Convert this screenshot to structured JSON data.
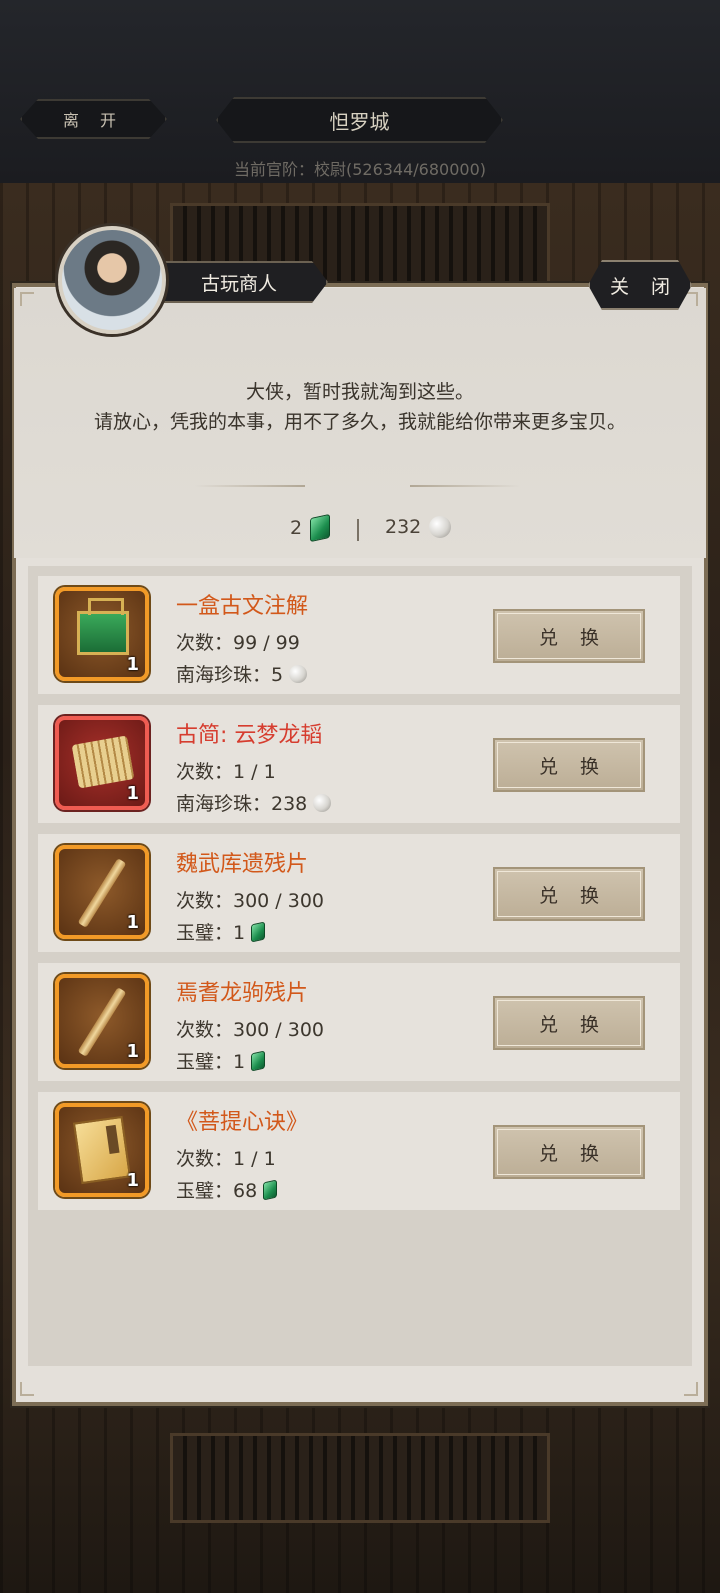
{
  "header": {
    "leave_label": "离 开",
    "city_title": "怛罗城",
    "rank_text": "当前官阶：校尉(526344/680000)"
  },
  "merchant": {
    "name": "古玩商人",
    "close_label": "关 闭",
    "dialog_line1": "大侠，暂时我就淘到这些。",
    "dialog_line2": "请放心，凭我的本事，用不了多久，我就能给你带来更多宝贝。"
  },
  "currency": {
    "jade_amount": "2",
    "separator": "|",
    "pearl_amount": "232",
    "jade_icon": "jade-icon",
    "pearl_icon": "pearl-icon"
  },
  "items": [
    {
      "name": "一盒古文注解",
      "name_color": "#d2581a",
      "count": "次数：99 / 99",
      "price_label": "南海珍珠：5",
      "currency_icon": "pearl",
      "qty": "1",
      "button": "兑 换",
      "frame": "orange",
      "art": "green-box"
    },
    {
      "name": "古简: 云梦龙韬",
      "name_color": "#d63d2f",
      "count": "次数：1 / 1",
      "price_label": "南海珍珠：238",
      "currency_icon": "pearl",
      "qty": "1",
      "button": "兑 换",
      "frame": "red",
      "art": "bamboo-scroll"
    },
    {
      "name": "魏武库遗残片",
      "name_color": "#d2581a",
      "count": "次数：300 / 300",
      "price_label": "玉璧：1",
      "currency_icon": "jade",
      "qty": "1",
      "button": "兑 换",
      "frame": "orange",
      "art": "bamboo-slip"
    },
    {
      "name": "焉耆龙驹残片",
      "name_color": "#d2581a",
      "count": "次数：300 / 300",
      "price_label": "玉璧：1",
      "currency_icon": "jade",
      "qty": "1",
      "button": "兑 换",
      "frame": "orange",
      "art": "bamboo-slip"
    },
    {
      "name": "《菩提心诀》",
      "name_color": "#d2581a",
      "count": "次数：1 / 1",
      "price_label": "玉璧：68",
      "currency_icon": "jade",
      "qty": "1",
      "button": "兑 换",
      "frame": "orange",
      "art": "book"
    }
  ]
}
